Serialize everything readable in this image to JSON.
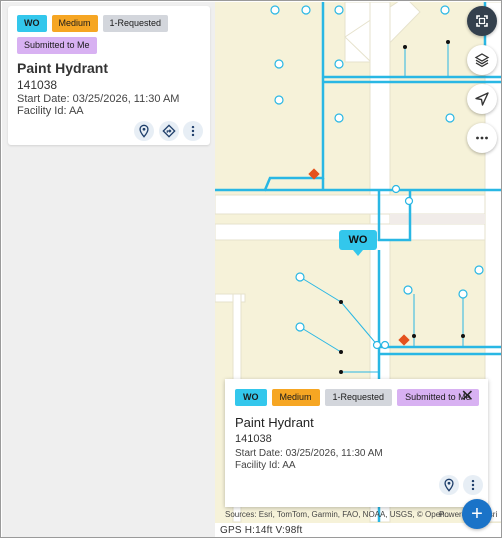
{
  "card": {
    "badges": {
      "wo": "WO",
      "priority": "Medium",
      "status": "1-Requested",
      "assignment": "Submitted to Me"
    },
    "title": "Paint Hydrant",
    "id": "141038",
    "start_date": "Start Date: 03/25/2026, 11:30 AM",
    "facility": "Facility Id: AA"
  },
  "map": {
    "marker_label": "WO",
    "controls": [
      "expand-icon",
      "layers-icon",
      "navigate-icon",
      "more-icon"
    ],
    "attribution": "Sources: Esri, TomTom, Garmin, FAO, NOAA, USGS, © Open...",
    "powered": "Powered by Esri",
    "colors": {
      "pipe": "#29b7e4",
      "land": "#f6f2d9",
      "road": "#ffffff",
      "wo": "#33c7ec",
      "medium": "#f6a623",
      "requested": "#d3d6dc",
      "submitted": "#d8b1f2",
      "fab": "#1a73c8"
    }
  },
  "popup": {
    "badges": {
      "wo": "WO",
      "priority": "Medium",
      "status": "1-Requested",
      "assignment": "Submitted to Me"
    },
    "title": "Paint Hydrant",
    "id": "141038",
    "start_date": "Start Date: 03/25/2026, 11:30 AM",
    "facility": "Facility Id: AA",
    "close": "✕"
  },
  "gps": "GPS  H:14ft  V:98ft",
  "fab_label": "+"
}
